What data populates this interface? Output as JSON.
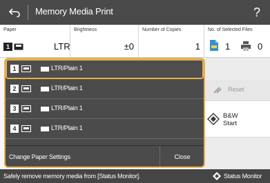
{
  "titlebar": {
    "title": "Memory Media Print",
    "help_label": "?",
    "back_icon": "back-arrow-icon"
  },
  "info": {
    "paper": {
      "caption": "Paper",
      "slot": "1",
      "size": "LTR"
    },
    "brightness": {
      "caption": "Brightness",
      "value": "±0"
    },
    "copies": {
      "caption": "Number of Copies",
      "value": "1"
    },
    "files": {
      "caption": "No. of Selected Files",
      "selected": "1",
      "print_count": "0"
    }
  },
  "paper_popup": {
    "selected_index": 0,
    "sources": [
      {
        "slot": "1",
        "label": "LTR/Plain 1"
      },
      {
        "slot": "2",
        "label": "LTR/Plain 1"
      },
      {
        "slot": "3",
        "label": "LTR/Plain 1"
      },
      {
        "slot": "4",
        "label": "LTR/Plain 1"
      }
    ],
    "change_label": "Change Paper Settings",
    "close_label": "Close"
  },
  "actions": {
    "reset_label": "Reset",
    "start_line1": "B&W",
    "start_line2": "Start"
  },
  "statusbar": {
    "message": "Safely remove memory media from [Status Monitor].",
    "monitor_label": "Status Monitor"
  },
  "colors": {
    "accent": "#e6b04e",
    "titlebar": "#4a4a4a",
    "popup_bg": "#4b4b4b",
    "statusbar": "#454545",
    "file_icon": "#3a8fc9"
  }
}
